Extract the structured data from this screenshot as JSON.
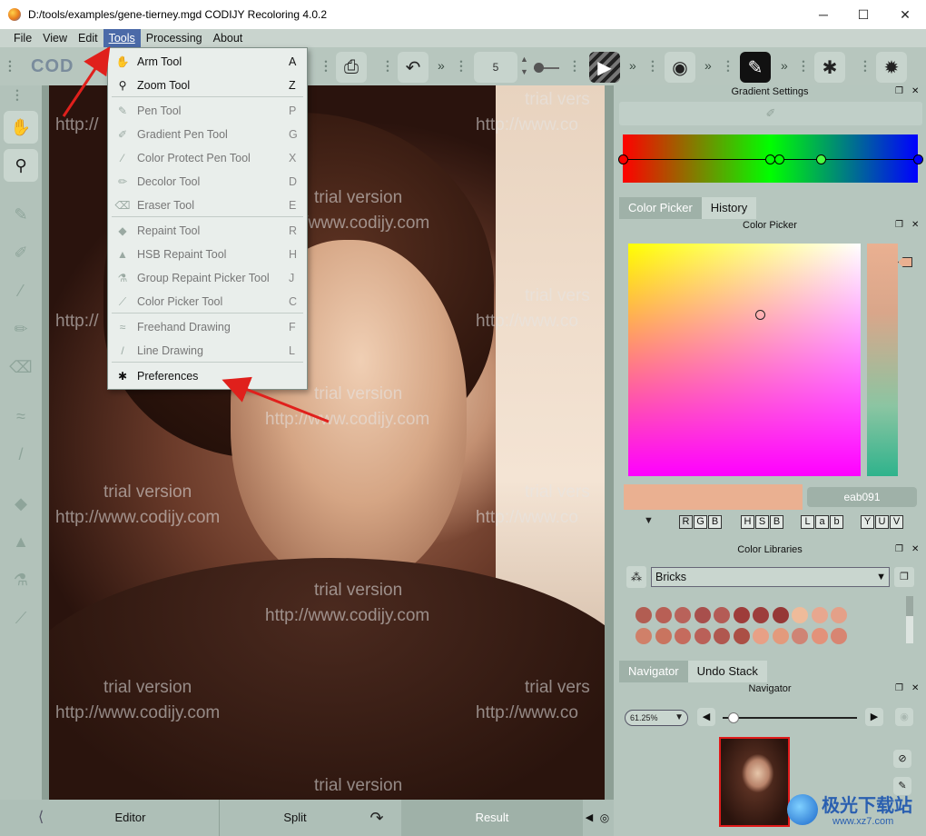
{
  "window": {
    "title": "D:/tools/examples/gene-tierney.mgd CODIJY Recoloring 4.0.2",
    "controls": {
      "minimize": "─",
      "maximize": "☐",
      "close": "✕"
    }
  },
  "menubar": {
    "items": [
      "File",
      "View",
      "Edit",
      "Tools",
      "Processing",
      "About"
    ],
    "active": "Tools"
  },
  "toolbar": {
    "logo_text": "COD",
    "brush_size": "5",
    "icons": [
      "print-icon",
      "undo-icon",
      "play-icon",
      "eye-icon",
      "pen-icon",
      "settings-icon",
      "bug-icon"
    ]
  },
  "tools_menu": {
    "items": [
      {
        "label": "Arm Tool",
        "key": "A",
        "enabled": true,
        "icon": "hand-icon"
      },
      {
        "label": "Zoom Tool",
        "key": "Z",
        "enabled": true,
        "icon": "search-icon"
      },
      {
        "label": "Pen Tool",
        "key": "P",
        "enabled": false,
        "icon": "pen-icon"
      },
      {
        "label": "Gradient Pen Tool",
        "key": "G",
        "enabled": false,
        "icon": "gradient-pen-icon"
      },
      {
        "label": "Color Protect Pen Tool",
        "key": "X",
        "enabled": false,
        "icon": "protect-pen-icon"
      },
      {
        "label": "Decolor Tool",
        "key": "D",
        "enabled": false,
        "icon": "decolor-icon"
      },
      {
        "label": "Eraser Tool",
        "key": "E",
        "enabled": false,
        "icon": "eraser-icon"
      },
      {
        "label": "Repaint Tool",
        "key": "R",
        "enabled": false,
        "icon": "repaint-icon"
      },
      {
        "label": "HSB Repaint Tool",
        "key": "H",
        "enabled": false,
        "icon": "hsb-repaint-icon"
      },
      {
        "label": "Group Repaint Picker Tool",
        "key": "J",
        "enabled": false,
        "icon": "group-repaint-icon"
      },
      {
        "label": "Color Picker Tool",
        "key": "C",
        "enabled": false,
        "icon": "color-picker-icon"
      },
      {
        "label": "Freehand Drawing",
        "key": "F",
        "enabled": false,
        "icon": "freehand-icon"
      },
      {
        "label": "Line Drawing",
        "key": "L",
        "enabled": false,
        "icon": "line-icon"
      },
      {
        "label": "Preferences",
        "key": "",
        "enabled": true,
        "icon": "gear-icon"
      }
    ]
  },
  "watermark": {
    "line1": "trial version",
    "line2": "http://www.codijy.com",
    "partial1": "trial vers",
    "partial2": "http://www.co",
    "partial3": "http://"
  },
  "bottombar": {
    "editor": "Editor",
    "split": "Split",
    "result": "Result"
  },
  "panels": {
    "gradient_settings": "Gradient Settings",
    "color_picker_tab": "Color Picker",
    "history_tab": "History",
    "color_picker_title": "Color Picker",
    "hex_value": "eab091",
    "modes": [
      [
        "R",
        "G",
        "B"
      ],
      [
        "H",
        "S",
        "B"
      ],
      [
        "L",
        "a",
        "b"
      ],
      [
        "Y",
        "U",
        "V"
      ]
    ],
    "color_libraries": "Color Libraries",
    "library_selected": "Bricks",
    "navigator_tab": "Navigator",
    "undo_tab": "Undo Stack",
    "navigator_title": "Navigator",
    "zoom_value": "61.25%"
  },
  "colors": {
    "current_color": "#eab091",
    "gradient": [
      "#ff0000",
      "#00ff00",
      "#0000ff"
    ],
    "palette_row1": [
      "#b25d52",
      "#b85f55",
      "#b9625a",
      "#a84f4c",
      "#b45b55",
      "#9e3c3a",
      "#9d3d3b",
      "#963836",
      "#efbb9a",
      "#e8a78f",
      "#e4a088"
    ],
    "palette_row2": [
      "#d08069",
      "#c9745f",
      "#c56b5d",
      "#ba6058",
      "#b0574f",
      "#ab4f45",
      "#e8a086",
      "#e39a7c",
      "#cf8475",
      "#e3927a",
      "#d88572"
    ]
  },
  "site_logo": {
    "line1": "极光下载站",
    "line2": "www.xz7.com"
  }
}
